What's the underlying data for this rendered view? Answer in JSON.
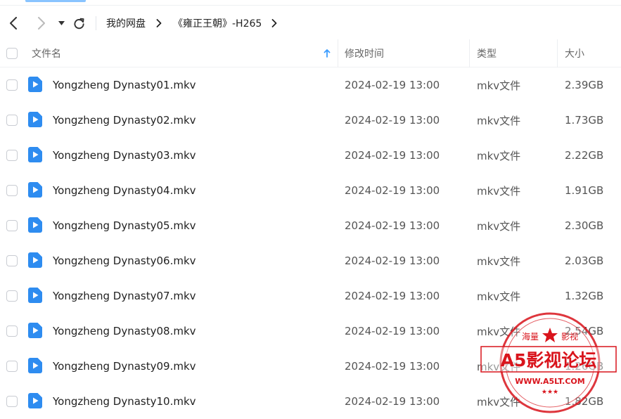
{
  "breadcrumb": {
    "root": "我的网盘",
    "folder": "《雍正王朝》-H265"
  },
  "columns": {
    "name": "文件名",
    "modified": "修改时间",
    "type": "类型",
    "size": "大小"
  },
  "files": [
    {
      "name": "Yongzheng Dynasty01.mkv",
      "modified": "2024-02-19 13:00",
      "type": "mkv文件",
      "size": "2.39GB"
    },
    {
      "name": "Yongzheng Dynasty02.mkv",
      "modified": "2024-02-19 13:00",
      "type": "mkv文件",
      "size": "1.73GB"
    },
    {
      "name": "Yongzheng Dynasty03.mkv",
      "modified": "2024-02-19 13:00",
      "type": "mkv文件",
      "size": "2.22GB"
    },
    {
      "name": "Yongzheng Dynasty04.mkv",
      "modified": "2024-02-19 13:00",
      "type": "mkv文件",
      "size": "1.91GB"
    },
    {
      "name": "Yongzheng Dynasty05.mkv",
      "modified": "2024-02-19 13:00",
      "type": "mkv文件",
      "size": "2.30GB"
    },
    {
      "name": "Yongzheng Dynasty06.mkv",
      "modified": "2024-02-19 13:00",
      "type": "mkv文件",
      "size": "2.03GB"
    },
    {
      "name": "Yongzheng Dynasty07.mkv",
      "modified": "2024-02-19 13:00",
      "type": "mkv文件",
      "size": "1.32GB"
    },
    {
      "name": "Yongzheng Dynasty08.mkv",
      "modified": "2024-02-19 13:00",
      "type": "mkv文件",
      "size": "2.54GB"
    },
    {
      "name": "Yongzheng Dynasty09.mkv",
      "modified": "2024-02-19 13:00",
      "type": "mkv文件",
      "size": "1.26GB"
    },
    {
      "name": "Yongzheng Dynasty10.mkv",
      "modified": "2024-02-19 13:00",
      "type": "mkv文件",
      "size": "1.82GB"
    }
  ],
  "watermark": {
    "top_left": "海量",
    "top_right": "影视",
    "title": "A5影视论坛",
    "url": "WWW.A5LT.COM"
  },
  "colors": {
    "accent": "#3b9cff",
    "file_icon": "#2e8cf0",
    "stamp_red": "#d9141c"
  },
  "icons": {
    "back": "chevron-left-icon",
    "forward": "chevron-right-icon",
    "history": "caret-down-icon",
    "refresh": "refresh-icon",
    "sort": "sort-ascending-icon",
    "file": "video-file-icon"
  }
}
